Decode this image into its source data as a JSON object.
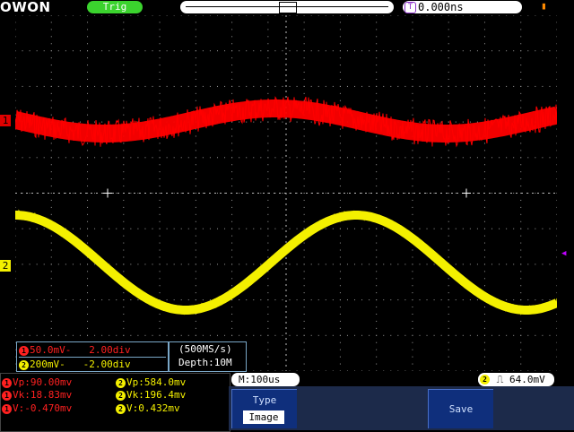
{
  "header": {
    "brand": "OWON",
    "run_state": "Trig",
    "horizontal_position_badge": "T",
    "horizontal_position": "0.000ns"
  },
  "channels": {
    "ch1": {
      "marker": "1",
      "color": "#ff2020",
      "scale": "50.0mV",
      "offset": "2.00div",
      "scale_text": "50.0mV-",
      "offset_text": "2.00div"
    },
    "ch2": {
      "marker": "2",
      "color": "#f4f000",
      "scale": "200mV",
      "offset": "-2.00div",
      "scale_text": "200mV-",
      "offset_text": "-2.00div"
    }
  },
  "acquisition": {
    "sample_rate": "(500MS/s)",
    "depth": "Depth:10M"
  },
  "timebase": "M:100us",
  "trigger": {
    "source": "2",
    "level": "64.0mV"
  },
  "measurements": {
    "ch1": {
      "vp": "Vp:90.00mv",
      "vk": "Vk:18.83mv",
      "v": "V:-0.470mv"
    },
    "ch2": {
      "vp": "Vp:584.0mv",
      "vk": "Vk:196.4mv",
      "v": "V:0.432mv"
    }
  },
  "menu": {
    "type_label": "Type",
    "type_value": "Image",
    "save_label": "Save"
  },
  "icons": {
    "battery": "battery-icon",
    "trigger_edge": "rising-edge-icon"
  }
}
